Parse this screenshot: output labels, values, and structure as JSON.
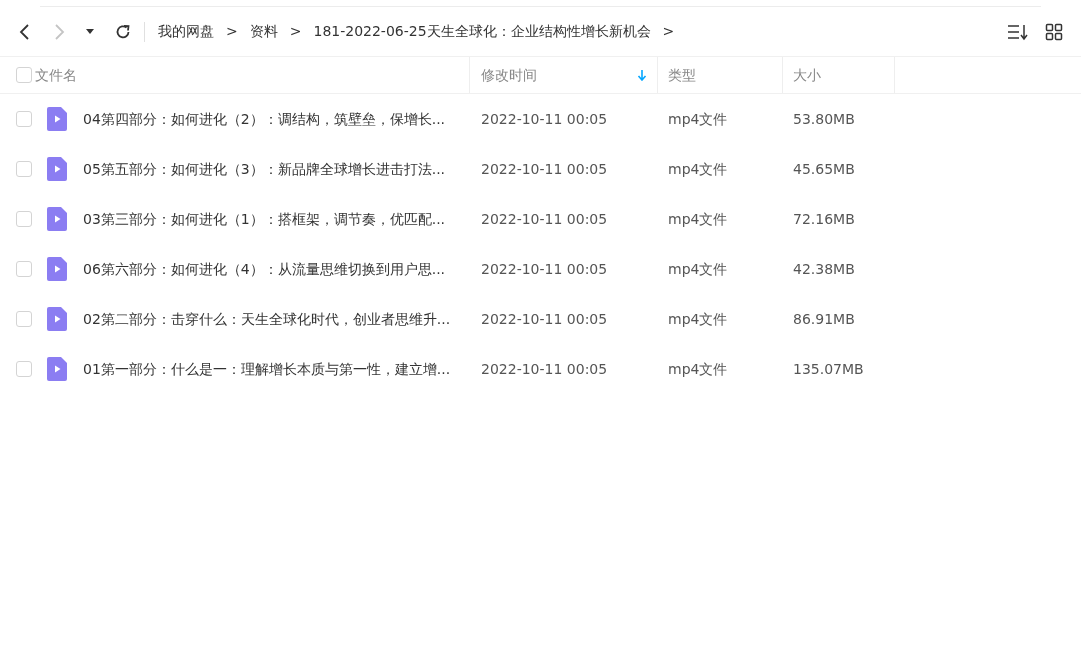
{
  "toolbar": {
    "nav": [
      {
        "kind": "back",
        "disabled": false
      },
      {
        "kind": "forward",
        "disabled": true
      },
      {
        "kind": "history",
        "disabled": false
      },
      {
        "kind": "refresh",
        "disabled": false
      }
    ],
    "breadcrumb": [
      {
        "kind": "crumb",
        "label": "我的网盘"
      },
      {
        "kind": "separator",
        "label": ">"
      },
      {
        "kind": "crumb",
        "label": "资料"
      },
      {
        "kind": "separator",
        "label": ">"
      },
      {
        "kind": "crumb",
        "label": "181-2022-06-25天生全球化：企业结构性增长新机会"
      },
      {
        "kind": "separator",
        "label": ">"
      }
    ]
  },
  "table": {
    "select_all": {
      "checked": false
    },
    "columns": [
      {
        "label": "文件名",
        "sorted": false
      },
      {
        "label": "修改时间",
        "sorted": true
      },
      {
        "label": "类型",
        "sorted": false
      },
      {
        "label": "大小",
        "sorted": false
      }
    ],
    "rows": [
      {
        "checked": false,
        "name": "04第四部分：如何进化（2）：调结构，筑壁垒，保增长...",
        "modified": "2022-10-11 00:05",
        "type": "mp4文件",
        "size": "53.80MB"
      },
      {
        "checked": false,
        "name": "05第五部分：如何进化（3）：新品牌全球增长进击打法...",
        "modified": "2022-10-11 00:05",
        "type": "mp4文件",
        "size": "45.65MB"
      },
      {
        "checked": false,
        "name": "03第三部分：如何进化（1）：搭框架，调节奏，优匹配...",
        "modified": "2022-10-11 00:05",
        "type": "mp4文件",
        "size": "72.16MB"
      },
      {
        "checked": false,
        "name": "06第六部分：如何进化（4）：从流量思维切换到用户思...",
        "modified": "2022-10-11 00:05",
        "type": "mp4文件",
        "size": "42.38MB"
      },
      {
        "checked": false,
        "name": "02第二部分：击穿什么：天生全球化时代，创业者思维升...",
        "modified": "2022-10-11 00:05",
        "type": "mp4文件",
        "size": "86.91MB"
      },
      {
        "checked": false,
        "name": "01第一部分：什么是一：理解增长本质与第一性，建立增...",
        "modified": "2022-10-11 00:05",
        "type": "mp4文件",
        "size": "135.07MB"
      }
    ]
  }
}
